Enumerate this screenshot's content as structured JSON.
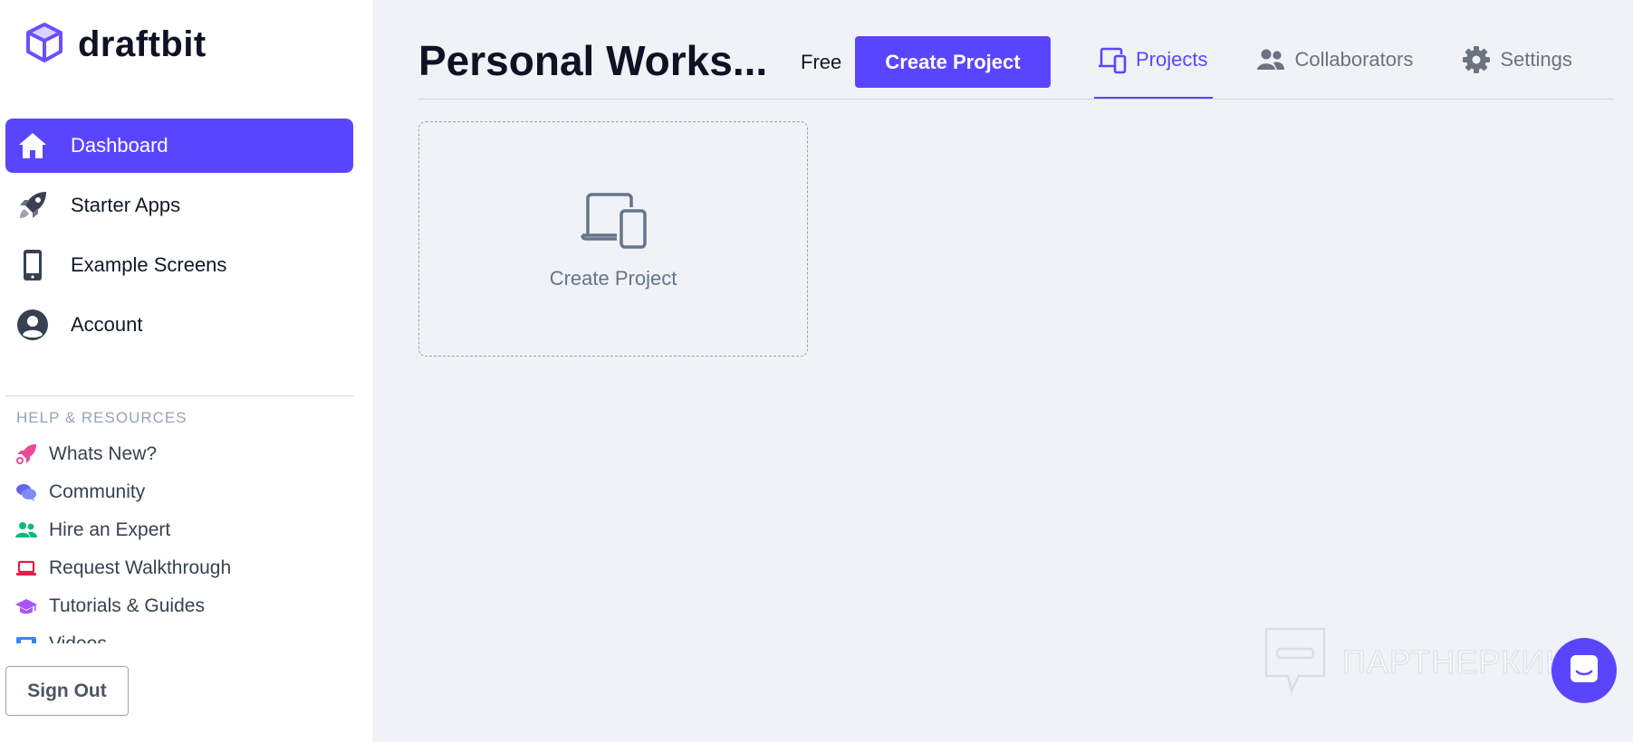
{
  "app": {
    "logo_text": "draftbit"
  },
  "sidebar": {
    "nav": [
      {
        "label": "Dashboard",
        "icon": "home-icon",
        "active": true
      },
      {
        "label": "Starter Apps",
        "icon": "rocket-icon"
      },
      {
        "label": "Example Screens",
        "icon": "phone-icon"
      },
      {
        "label": "Account",
        "icon": "user-circle-icon"
      }
    ],
    "help_heading": "HELP & RESOURCES",
    "help_items": [
      {
        "label": "Whats New?",
        "icon": "rocket-icon",
        "color": "#ec4899"
      },
      {
        "label": "Community",
        "icon": "chat-bubbles-icon",
        "color": "#6366f1"
      },
      {
        "label": "Hire an Expert",
        "icon": "users-icon",
        "color": "#10b981"
      },
      {
        "label": "Request Walkthrough",
        "icon": "laptop-icon",
        "color": "#e11d48"
      },
      {
        "label": "Tutorials & Guides",
        "icon": "graduation-cap-icon",
        "color": "#a855f7"
      },
      {
        "label": "Videos",
        "icon": "film-icon",
        "color": "#3b82f6"
      }
    ],
    "sign_out_label": "Sign Out"
  },
  "header": {
    "title": "Personal Works...",
    "plan_label": "Free",
    "create_button_label": "Create Project",
    "tabs": [
      {
        "label": "Projects",
        "icon": "devices-icon",
        "active": true
      },
      {
        "label": "Collaborators",
        "icon": "users-icon"
      },
      {
        "label": "Settings",
        "icon": "gear-icon"
      }
    ]
  },
  "main": {
    "create_card_label": "Create Project"
  },
  "watermark": {
    "text": "ПАРТНЕРКИН"
  },
  "colors": {
    "accent": "#5a45ff",
    "background": "#f0f2f7"
  }
}
